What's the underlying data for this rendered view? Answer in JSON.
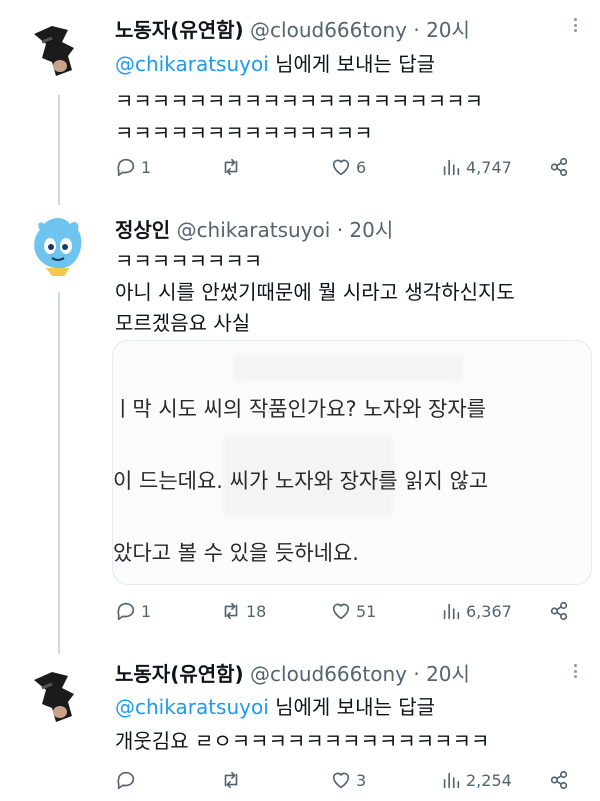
{
  "tweets": [
    {
      "author_name": "노동자(유연함)",
      "handle": "@cloud666tony",
      "separator": "·",
      "time": "20시",
      "reply_prefix": "@chikaratsuyoi",
      "reply_suffix": " 님에게 보내는 답글",
      "lines": [
        "ㅋㅋㅋㅋㅋㅋㅋㅋㅋㅋㅋㅋㅋㅋㅋㅋㅋㅋㅋㅋ",
        "ㅋㅋㅋㅋㅋㅋㅋㅋㅋㅋㅋㅋㅋㅋ"
      ],
      "stats": {
        "replies": "1",
        "retweets": "",
        "likes": "6",
        "views": "4,747"
      }
    },
    {
      "author_name": "정상인",
      "handle": "@chikaratsuyoi",
      "separator": "·",
      "time": "20시",
      "lines": [
        "ㅋㅋㅋㅋㅋㅋㅋㅋ",
        "아니 시를 안썼기때문에 뭘 시라고 생각하신지도",
        "모르겠음요 사실"
      ],
      "media_lines": [
        "ㅣ막 시도        씨의 작품인가요? 노자와 장자를",
        "이 드는데요.         씨가 노자와 장자를 읽지 않고",
        "았다고 볼 수 있을 듯하네요."
      ],
      "stats": {
        "replies": "1",
        "retweets": "18",
        "likes": "51",
        "views": "6,367"
      }
    },
    {
      "author_name": "노동자(유연함)",
      "handle": "@cloud666tony",
      "separator": "·",
      "time": "20시",
      "reply_prefix": "@chikaratsuyoi",
      "reply_suffix": " 님에게 보내는 답글",
      "lines": [
        "개웃김요 ㄹㅇㅋㅋㅋㅋㅋㅋㅋㅋㅋㅋㅋㅋㅋㅋ"
      ],
      "stats": {
        "replies": "",
        "retweets": "",
        "likes": "3",
        "views": "2,254"
      }
    }
  ],
  "colors": {
    "link": "#1d9bf0",
    "muted": "#536471",
    "thread_line": "#cfd9de"
  }
}
